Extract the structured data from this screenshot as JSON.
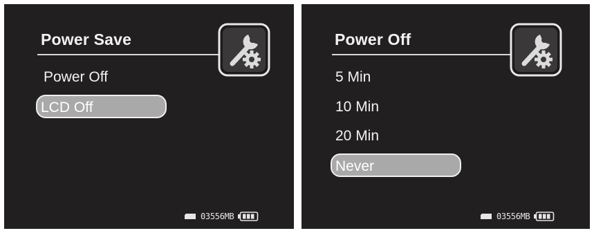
{
  "screen_left": {
    "title": "Power Save",
    "icon": "wrench-gear-icon",
    "items": [
      {
        "label": "Power Off",
        "selected": false
      },
      {
        "label": "LCD Off",
        "selected": true
      }
    ],
    "status": {
      "memory": "03556MB",
      "battery_icon": "battery-icon",
      "card_icon": "memory-card-icon"
    }
  },
  "screen_right": {
    "title": "Power Off",
    "icon": "wrench-gear-icon",
    "items": [
      {
        "label": "5 Min",
        "selected": false
      },
      {
        "label": "10 Min",
        "selected": false
      },
      {
        "label": "20 Min",
        "selected": false
      },
      {
        "label": "Never",
        "selected": true
      }
    ],
    "status": {
      "memory": "03556MB",
      "battery_icon": "battery-icon",
      "card_icon": "memory-card-icon"
    }
  },
  "colors": {
    "background": "#221f20",
    "text": "#f2f2f2",
    "highlight": "#a9a9a9",
    "highlight_border": "#f0f0f0"
  }
}
